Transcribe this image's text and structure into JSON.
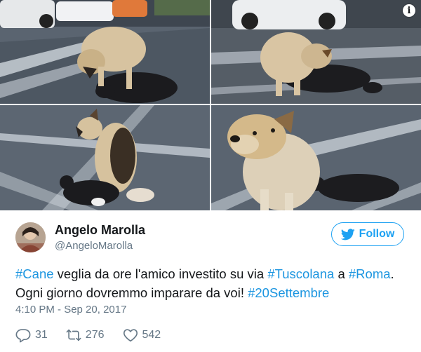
{
  "photos": [
    {
      "alt": "dog-over-cat-1"
    },
    {
      "alt": "dog-over-cat-2"
    },
    {
      "alt": "dog-beside-cat-3"
    },
    {
      "alt": "dog-closeup-4"
    }
  ],
  "info_icon": {
    "glyph": "i"
  },
  "user": {
    "name": "Angelo Marolla",
    "handle": "@AngeloMarolla"
  },
  "follow": {
    "label": "Follow"
  },
  "tweet": {
    "segments": [
      {
        "text": "#Cane",
        "tag": true
      },
      {
        "text": " veglia da ore l'amico investito su via ",
        "tag": false
      },
      {
        "text": "#Tuscolana",
        "tag": true
      },
      {
        "text": " a ",
        "tag": false
      },
      {
        "text": "#Roma",
        "tag": true
      },
      {
        "text": ". Ogni giorno dovremmo imparare da voi! ",
        "tag": false
      },
      {
        "text": "#20Settembre",
        "tag": true
      }
    ]
  },
  "timestamp": "4:10 PM - Sep 20, 2017",
  "actions": {
    "replies": "31",
    "retweets": "276",
    "likes": "542"
  },
  "colors": {
    "accent": "#1da1f2",
    "hashtag": "#1b95e0",
    "secondary_text": "#657786"
  }
}
